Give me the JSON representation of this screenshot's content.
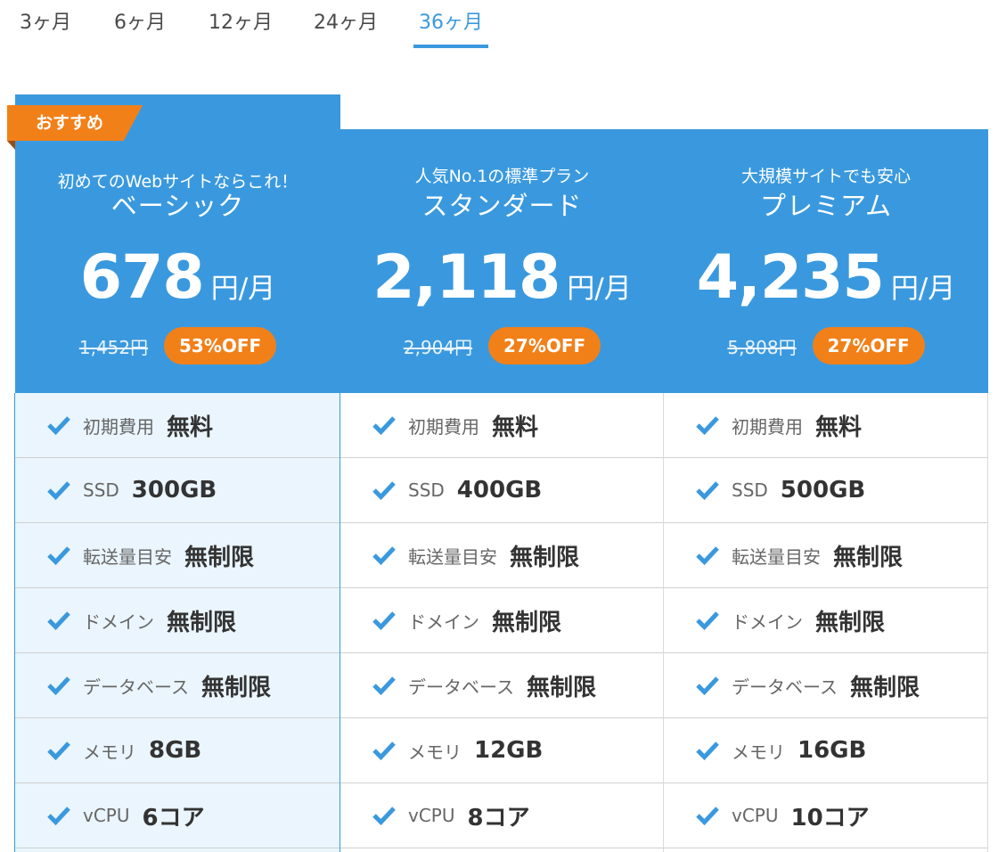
{
  "tabs": [
    {
      "label": "3ヶ月",
      "active": false
    },
    {
      "label": "6ヶ月",
      "active": false
    },
    {
      "label": "12ヶ月",
      "active": false
    },
    {
      "label": "24ヶ月",
      "active": false
    },
    {
      "label": "36ヶ月",
      "active": true
    }
  ],
  "colors": {
    "primary": "#3a99de",
    "accent": "#f28019",
    "highlight_bg": "#eaf5fd"
  },
  "recommend_badge": "おすすめ",
  "plans": [
    {
      "tagline": "初めてのWebサイトならこれ！",
      "name": "ベーシック",
      "price": "678",
      "unit": "円/月",
      "original_price": "1,452円",
      "discount": "53%OFF",
      "features": [
        {
          "label": "初期費用",
          "value": "無料"
        },
        {
          "label": "SSD",
          "value": "300GB"
        },
        {
          "label": "転送量目安",
          "value": "無制限"
        },
        {
          "label": "ドメイン",
          "value": "無制限"
        },
        {
          "label": "データベース",
          "value": "無制限"
        },
        {
          "label": "メモリ",
          "value": "8GB"
        },
        {
          "label": "vCPU",
          "value": "6コア"
        }
      ]
    },
    {
      "tagline": "人気No.1の標準プラン",
      "name": "スタンダード",
      "price": "2,118",
      "unit": "円/月",
      "original_price": "2,904円",
      "discount": "27%OFF",
      "features": [
        {
          "label": "初期費用",
          "value": "無料"
        },
        {
          "label": "SSD",
          "value": "400GB"
        },
        {
          "label": "転送量目安",
          "value": "無制限"
        },
        {
          "label": "ドメイン",
          "value": "無制限"
        },
        {
          "label": "データベース",
          "value": "無制限"
        },
        {
          "label": "メモリ",
          "value": "12GB"
        },
        {
          "label": "vCPU",
          "value": "8コア"
        }
      ]
    },
    {
      "tagline": "大規模サイトでも安心",
      "name": "プレミアム",
      "price": "4,235",
      "unit": "円/月",
      "original_price": "5,808円",
      "discount": "27%OFF",
      "features": [
        {
          "label": "初期費用",
          "value": "無料"
        },
        {
          "label": "SSD",
          "value": "500GB"
        },
        {
          "label": "転送量目安",
          "value": "無制限"
        },
        {
          "label": "ドメイン",
          "value": "無制限"
        },
        {
          "label": "データベース",
          "value": "無制限"
        },
        {
          "label": "メモリ",
          "value": "16GB"
        },
        {
          "label": "vCPU",
          "value": "10コア"
        }
      ]
    }
  ]
}
